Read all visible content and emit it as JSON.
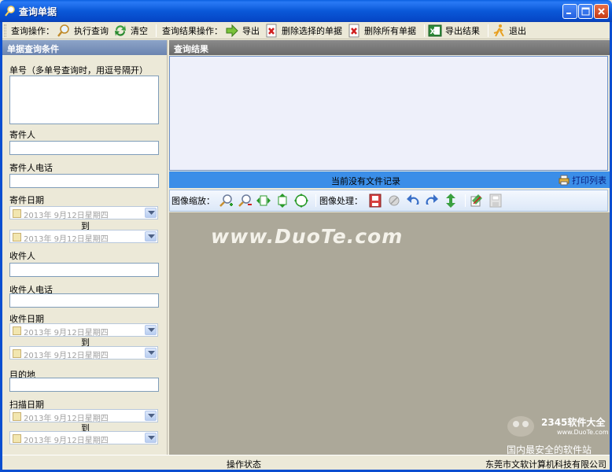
{
  "window": {
    "title": "查询单据"
  },
  "toolbar": {
    "query_ops_label": "查询操作：",
    "execute_query": "执行查询",
    "clear": "清空",
    "result_ops_label": "查询结果操作：",
    "export": "导出",
    "delete_selected": "删除选择的单据",
    "delete_all": "删除所有单据",
    "export_results": "导出结果",
    "exit": "退出"
  },
  "left_panel": {
    "header": "单据查询条件",
    "order_no_label": "单号（多单号查询时，用逗号隔开）",
    "sender_label": "寄件人",
    "sender_phone_label": "寄件人电话",
    "send_date_label": "寄件日期",
    "receiver_label": "收件人",
    "receiver_phone_label": "收件人电话",
    "receive_date_label": "收件日期",
    "destination_label": "目的地",
    "scan_date_label": "扫描日期",
    "to_label": "到",
    "date_value": "2013年  9月12日星期四"
  },
  "right_panel": {
    "header": "查询结果",
    "no_records": "当前没有文件记录",
    "print_list": "打印列表",
    "zoom_label": "图像缩放：",
    "process_label": "图像处理："
  },
  "watermark": {
    "site": "www.DuoTe.com",
    "brand": "2345软件大全",
    "brand_url": "www.DuoTe.com",
    "slogan": "国内最安全的软件站"
  },
  "status": {
    "operation": "操作状态",
    "company": "东莞市文软计算机科技有限公司"
  }
}
